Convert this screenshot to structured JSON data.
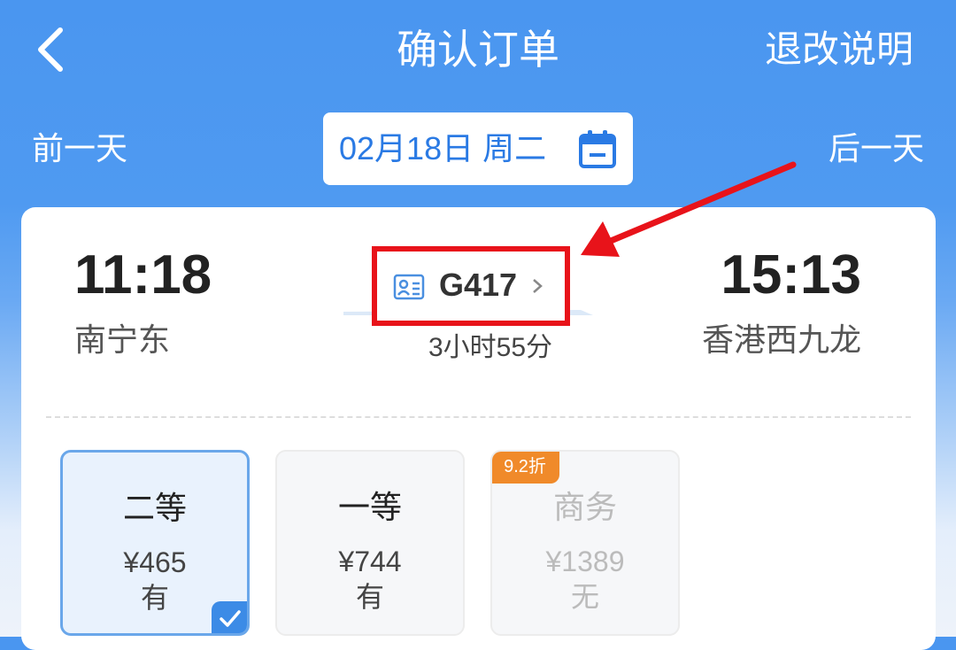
{
  "header": {
    "title": "确认订单",
    "refund_link": "退改说明"
  },
  "date_nav": {
    "prev": "前一天",
    "next": "后一天",
    "date": "02月18日 周二"
  },
  "train": {
    "departure_time": "11:18",
    "departure_station": "南宁东",
    "arrival_time": "15:13",
    "arrival_station": "香港西九龙",
    "number": "G417",
    "duration": "3小时55分"
  },
  "seats": [
    {
      "name": "二等",
      "price": "¥465",
      "availability": "有",
      "selected": true
    },
    {
      "name": "一等",
      "price": "¥744",
      "availability": "有"
    },
    {
      "name": "商务",
      "price": "¥1389",
      "availability": "无",
      "discount": "9.2折"
    }
  ],
  "colors": {
    "accent_blue": "#3c8be6",
    "highlight_red": "#e8131a",
    "discount_orange": "#f08a2a"
  },
  "icons": [
    "back-arrow-icon",
    "calendar-icon",
    "id-card-icon",
    "chevron-right-icon",
    "checkmark-icon"
  ]
}
